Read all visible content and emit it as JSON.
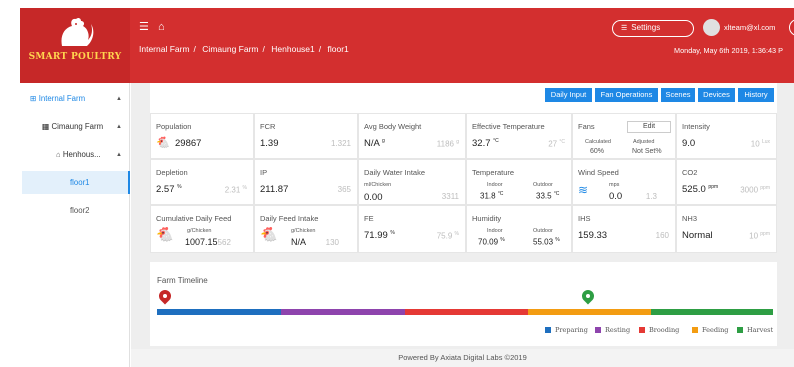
{
  "brand": {
    "logo_text": "SMART POULTRY",
    "colors": {
      "header": "#d32f2f",
      "accent": "#1e88e5",
      "logo_text": "#ffd54f"
    }
  },
  "header": {
    "breadcrumb": [
      "Internal Farm",
      "Cimaung Farm",
      "Henhouse1",
      "floor1"
    ],
    "settings_label": "Settings",
    "user_email": "xlteam@xl.com",
    "date": "Monday, May 6th 2019, 1:36:43 P"
  },
  "sidebar": {
    "items": [
      {
        "label": "Internal Farm"
      },
      {
        "label": "Cimaung Farm"
      },
      {
        "label": "Henhous..."
      },
      {
        "label": "floor1"
      },
      {
        "label": "floor2"
      }
    ]
  },
  "toolbar": {
    "buttons": [
      "Daily Input",
      "Fan Operations",
      "Scenes",
      "Devices",
      "History"
    ]
  },
  "cards": {
    "population": {
      "label": "Population",
      "value": "29867"
    },
    "fcr": {
      "label": "FCR",
      "value": "1.39",
      "target": "1.321"
    },
    "abw": {
      "label": "Avg Body Weight",
      "value": "N/A",
      "unit": "g",
      "target": "1186",
      "target_unit": "g"
    },
    "eff_temp": {
      "label": "Effective Temperature",
      "value": "32.7",
      "unit": "°C",
      "target": "27",
      "target_unit": "°C"
    },
    "fans": {
      "label": "Fans",
      "edit_label": "Edit",
      "calc_label": "Calculated",
      "calc_value": "60%",
      "adj_label": "Adjusted",
      "adj_value": "Not Set%"
    },
    "intensity": {
      "label": "Intensity",
      "value": "9.0",
      "target": "10",
      "target_unit": "Lux"
    },
    "depletion": {
      "label": "Depletion",
      "value": "2.57",
      "unit": "%",
      "target": "2.31",
      "target_unit": "%"
    },
    "ip": {
      "label": "IP",
      "value": "211.87",
      "target": "365"
    },
    "water": {
      "label": "Daily Water Intake",
      "sub": "ml/Chicken",
      "value": "0.00",
      "target": "3311"
    },
    "temperature": {
      "label": "Temperature",
      "indoor_label": "Indoor",
      "indoor": "31.8",
      "outdoor_label": "Outdoor",
      "outdoor": "33.5",
      "unit": "°C"
    },
    "wind": {
      "label": "Wind Speed",
      "unit": "mps",
      "value": "0.0",
      "target": "1.3"
    },
    "co2": {
      "label": "CO2",
      "value": "525.0",
      "unit": "ppm",
      "target": "3000",
      "target_unit": "ppm"
    },
    "cum_feed": {
      "label": "Cumulative Daily Feed",
      "sub": "g/Chicken",
      "value": "1007.15",
      "target": "562"
    },
    "daily_feed": {
      "label": "Daily Feed Intake",
      "sub": "g/Chicken",
      "value": "N/A",
      "target": "130"
    },
    "fe": {
      "label": "FE",
      "value": "71.99",
      "unit": "%",
      "target": "75.9",
      "target_unit": "%"
    },
    "humidity": {
      "label": "Humidity",
      "indoor_label": "Indoor",
      "indoor": "70.09",
      "outdoor_label": "Outdoor",
      "outdoor": "55.03",
      "unit": "%"
    },
    "ihs": {
      "label": "IHS",
      "value": "159.33",
      "target": "160"
    },
    "nh3": {
      "label": "NH3",
      "value": "Normal",
      "target": "10",
      "target_unit": "ppm"
    }
  },
  "timeline": {
    "title": "Farm Timeline",
    "phases": [
      {
        "name": "Preparing",
        "color": "#1e6fbf"
      },
      {
        "name": "Resting",
        "color": "#8e44ad"
      },
      {
        "name": "Brooding",
        "color": "#e53935"
      },
      {
        "name": "Feeding",
        "color": "#f39c12"
      },
      {
        "name": "Harvest",
        "color": "#2e9e44"
      }
    ]
  },
  "footer": {
    "text": "Powered By Axiata Digital Labs ©2019"
  }
}
